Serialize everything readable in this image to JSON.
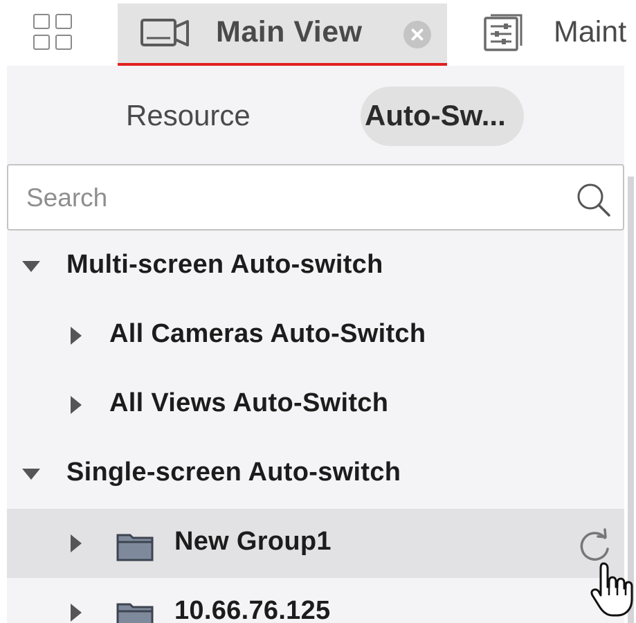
{
  "topbar": {
    "menu_icon": "grid-menu-icon",
    "tabs": [
      {
        "label": "Main View",
        "icon": "camera-icon",
        "active": true,
        "closable": true
      },
      {
        "label": "Maint",
        "icon": "maintenance-settings-icon",
        "active": false
      }
    ],
    "accent_color": "#e0201e"
  },
  "panel": {
    "tabs": [
      {
        "label": "Resource",
        "active": false
      },
      {
        "label": "Auto-Sw...",
        "active": true
      }
    ],
    "search": {
      "placeholder": "Search",
      "value": "",
      "icon": "search-icon"
    },
    "tree": [
      {
        "label": "Multi-screen Auto-switch",
        "level": 0,
        "expanded": true
      },
      {
        "label": "All Cameras Auto-Switch",
        "level": 1,
        "expanded": false
      },
      {
        "label": "All Views Auto-Switch",
        "level": 1,
        "expanded": false
      },
      {
        "label": "Single-screen Auto-switch",
        "level": 0,
        "expanded": true
      },
      {
        "label": "New Group1",
        "level": 1,
        "expanded": false,
        "icon": "folder-icon",
        "selected": true,
        "action_icon": "refresh-icon"
      },
      {
        "label": "10.66.76.125",
        "level": 1,
        "expanded": false,
        "icon": "folder-icon"
      }
    ]
  }
}
